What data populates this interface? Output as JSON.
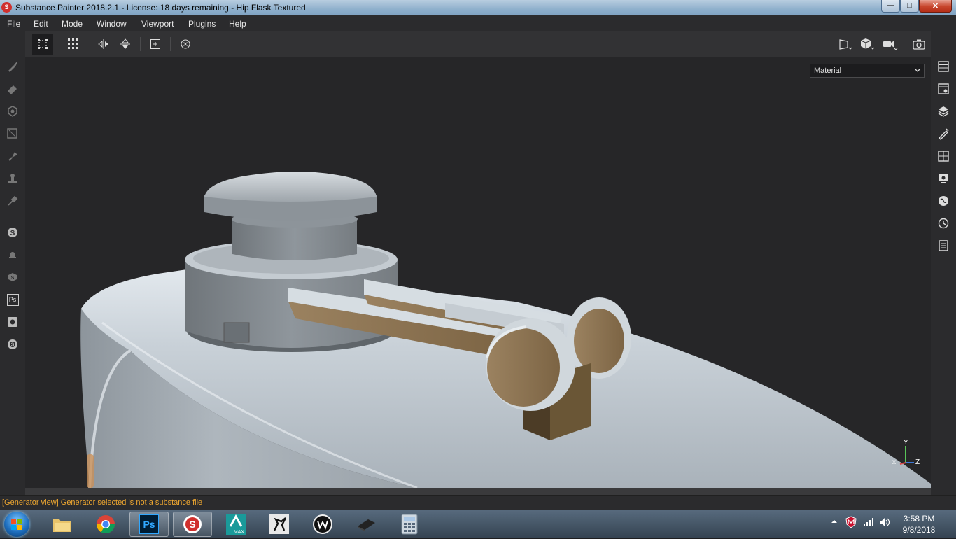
{
  "window": {
    "title": "Substance Painter 2018.2.1 - License: 18 days remaining - Hip Flask Textured",
    "logo": "S",
    "minimize_glyph": "—",
    "maximize_glyph": "□",
    "close_glyph": "✕"
  },
  "menu": [
    "File",
    "Edit",
    "Mode",
    "Window",
    "Viewport",
    "Plugins",
    "Help"
  ],
  "toolbar": {
    "icons": [
      "grid-single-icon",
      "grid-multi-icon",
      "mirror-x-icon",
      "mirror-y-icon",
      "fit-view-icon",
      "reset-icon"
    ],
    "right_icons": [
      "view-mode-icon",
      "cube-view-icon",
      "camera-icon",
      "screenshot-icon"
    ]
  },
  "left_tools": [
    "paint-brush-icon",
    "eraser-icon",
    "projection-icon",
    "polygon-fill-icon",
    "smudge-icon",
    "clone-stamp-icon",
    "color-picker-icon",
    "substance-share-icon",
    "notification-icon",
    "substance-source-icon",
    "photoshop-icon",
    "resource-icon",
    "substance-logo-icon"
  ],
  "left_tool_labels": {
    "photoshop": "Ps"
  },
  "right_tools": [
    "layers-icon",
    "texture-set-settings-icon",
    "layer-stack-icon",
    "properties-icon",
    "display-settings-icon",
    "viewer-settings-icon",
    "environment-icon",
    "history-icon",
    "log-icon"
  ],
  "viewport": {
    "display_mode": "Material",
    "axis_labels": {
      "y": "Y",
      "x": "x",
      "z": "Z"
    }
  },
  "status": {
    "message": "[Generator view] Generator selected is not a substance file"
  },
  "taskbar": {
    "apps": [
      "file-explorer-icon",
      "chrome-icon",
      "photoshop-taskbar-icon",
      "substance-painter-taskbar-icon",
      "3ds-max-icon",
      "zbrush-icon",
      "wacom-icon",
      "storage-icon",
      "calculator-icon"
    ],
    "ps_label": "Ps",
    "max_label": "MAX",
    "time": "3:58 PM",
    "date": "9/8/2018"
  },
  "colors": {
    "accent_substance": "#d0302d",
    "status_warning": "#f0a830",
    "metal": "#c9d0d6",
    "leather": "#8b7350"
  }
}
